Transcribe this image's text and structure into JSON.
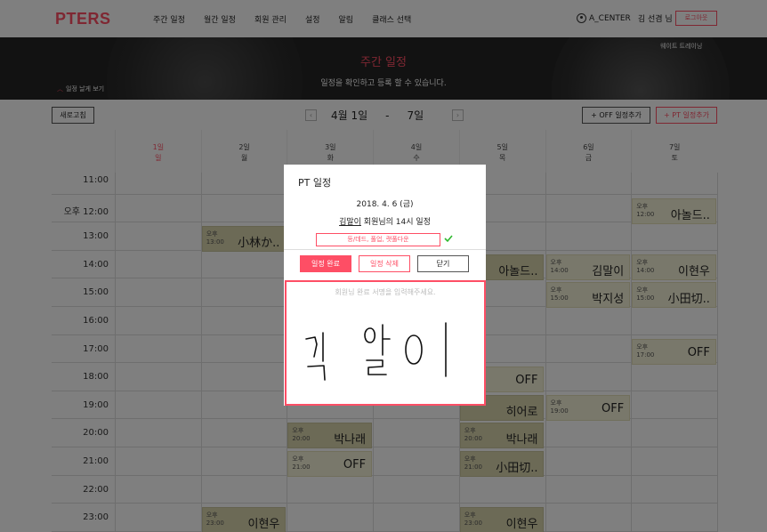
{
  "app": {
    "logo": "PTERS",
    "menu": [
      "주간 일정",
      "월간 일정",
      "회원 관리",
      "설정",
      "알림",
      "클래스 선택"
    ],
    "user_id": "A_CENTER",
    "user_name": "김 선겸 님",
    "logout": "로그아웃"
  },
  "banner": {
    "title": "주간 일정",
    "subtitle": "일정을 확인하고 등록 할 수 있습니다.",
    "trainer_label": "웨이트 트레이닝",
    "detail_toggle": "일정 날게 보기"
  },
  "toolbar": {
    "refresh": "새로고침",
    "prev": "‹",
    "next": "›",
    "range_start": "4월 1일",
    "range_dash": "-",
    "range_end": "7일",
    "add_off": "+ OFF 일정추가",
    "add_pt": "+ PT 일정추가"
  },
  "week": [
    {
      "date": "1일",
      "weekday": "일"
    },
    {
      "date": "2일",
      "weekday": "월"
    },
    {
      "date": "3일",
      "weekday": "화"
    },
    {
      "date": "4일",
      "weekday": "수"
    },
    {
      "date": "5일",
      "weekday": "목"
    },
    {
      "date": "6일",
      "weekday": "금"
    },
    {
      "date": "7일",
      "weekday": "토"
    }
  ],
  "times": [
    "11:00",
    "오후  12:00",
    "13:00",
    "14:00",
    "15:00",
    "16:00",
    "17:00",
    "18:00",
    "19:00",
    "20:00",
    "21:00",
    "22:00",
    "23:00"
  ],
  "events": [
    {
      "day": 6,
      "row": 1,
      "ampm": "오후",
      "time": "12:00",
      "name": "아놀드..",
      "dark": false
    },
    {
      "day": 1,
      "row": 2,
      "ampm": "오후",
      "time": "13:00",
      "name": "小林か..",
      "dark": true
    },
    {
      "day": 4,
      "row": 3,
      "ampm": "",
      "time": "",
      "name": "아놀드..",
      "dark": true
    },
    {
      "day": 5,
      "row": 3,
      "ampm": "오후",
      "time": "14:00",
      "name": "김말이",
      "dark": false
    },
    {
      "day": 6,
      "row": 3,
      "ampm": "오후",
      "time": "14:00",
      "name": "이현우",
      "dark": false
    },
    {
      "day": 5,
      "row": 4,
      "ampm": "오후",
      "time": "15:00",
      "name": "박지성",
      "dark": false
    },
    {
      "day": 6,
      "row": 4,
      "ampm": "오후",
      "time": "15:00",
      "name": "小田切..",
      "dark": false
    },
    {
      "day": 6,
      "row": 6,
      "ampm": "오후",
      "time": "17:00",
      "name": "OFF",
      "dark": false
    },
    {
      "day": 4,
      "row": 7,
      "ampm": "",
      "time": "",
      "name": "OFF",
      "dark": false
    },
    {
      "day": 4,
      "row": 8,
      "ampm": "",
      "time": "19:00",
      "name": "히어로",
      "dark": true
    },
    {
      "day": 5,
      "row": 8,
      "ampm": "오후",
      "time": "19:00",
      "name": "OFF",
      "dark": false
    },
    {
      "day": 2,
      "row": 9,
      "ampm": "오후",
      "time": "20:00",
      "name": "박나래",
      "dark": true
    },
    {
      "day": 4,
      "row": 9,
      "ampm": "오후",
      "time": "20:00",
      "name": "박나래",
      "dark": true
    },
    {
      "day": 2,
      "row": 10,
      "ampm": "오후",
      "time": "21:00",
      "name": "OFF",
      "dark": false
    },
    {
      "day": 4,
      "row": 10,
      "ampm": "오후",
      "time": "21:00",
      "name": "小田切..",
      "dark": true
    },
    {
      "day": 1,
      "row": 12,
      "ampm": "오후",
      "time": "23:00",
      "name": "이현우",
      "dark": true
    },
    {
      "day": 4,
      "row": 12,
      "ampm": "오후",
      "time": "23:00",
      "name": "이현우",
      "dark": true
    }
  ],
  "modal": {
    "title": "PT 일정",
    "date": "2018. 4. 6 (금)",
    "member_name": "김말이",
    "member_suffix": " 회원님의 14시 일정",
    "tag": "등/데드, 풀업, 랫풀다운",
    "complete": "일정 완료",
    "delete": "일정 삭제",
    "close": "닫기",
    "signature_placeholder": "회원님 완료 서명을 입력해주세요.",
    "signature": "김 말이"
  },
  "colors": {
    "accent": "#fe4e65",
    "event_light": "#f3f1d6",
    "event_dark": "#d9d5ad",
    "check": "#2eb82e"
  }
}
